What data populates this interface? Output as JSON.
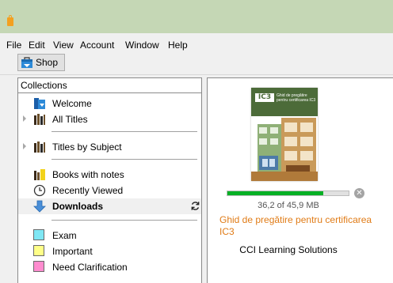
{
  "window": {
    "app_icon": "bag-icon"
  },
  "menu": [
    "File",
    "Edit",
    "View",
    "Account",
    "Window",
    "Help"
  ],
  "toolbar": {
    "shop_label": "Shop",
    "shop_icon": "shop-icon"
  },
  "sidebar": {
    "header": "Collections",
    "items": [
      {
        "label": "Welcome",
        "icon": "welcome-icon"
      },
      {
        "label": "All Titles",
        "icon": "books-icon",
        "expandable": true
      },
      {
        "label": "Titles by Subject",
        "icon": "books-icon",
        "expandable": true
      },
      {
        "label": "Books with notes",
        "icon": "notes-icon"
      },
      {
        "label": "Recently Viewed",
        "icon": "clock-icon"
      },
      {
        "label": "Downloads",
        "icon": "download-arrow-icon",
        "selected": true,
        "action_icon": "sync-icon"
      }
    ],
    "tags": [
      {
        "label": "Exam",
        "color": "#7fe7f4"
      },
      {
        "label": "Important",
        "color": "#ffff88"
      },
      {
        "label": "Need Clarification",
        "color": "#ff8ccf"
      }
    ]
  },
  "download": {
    "cover_badge": "IC3",
    "cover_title": "Ghid de pregătire pentru certificarea IC3",
    "progress_fraction": 0.79,
    "size_text": "36,2 of 45,9 MB",
    "book_title": "Ghid de pregătire pentru certificarea IC3",
    "publisher": "CCI Learning Solutions",
    "colors": {
      "progress": "#06b025",
      "title": "#e07b16"
    }
  }
}
